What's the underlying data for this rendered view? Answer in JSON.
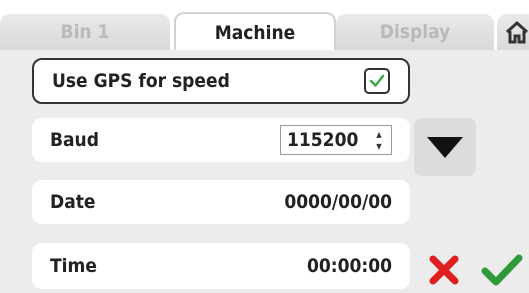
{
  "tabs": [
    {
      "label": "Bin 1",
      "active": false
    },
    {
      "label": "Machine",
      "active": true
    },
    {
      "label": "Display",
      "active": false
    }
  ],
  "home_icon": "home-icon",
  "settings": {
    "gps": {
      "label": "Use GPS for speed",
      "checked": true
    },
    "baud": {
      "label": "Baud",
      "value": "115200"
    },
    "date": {
      "label": "Date",
      "value": "0000/00/00"
    },
    "time": {
      "label": "Time",
      "value": "00:00:00"
    }
  },
  "icons": {
    "dropdown": "triangle-down-icon",
    "cancel": "cross-icon",
    "confirm": "checkmark-icon"
  },
  "colors": {
    "cancel": "#e02020",
    "confirm": "#2f9a3a",
    "checkbox_mark": "#3aa84a"
  }
}
